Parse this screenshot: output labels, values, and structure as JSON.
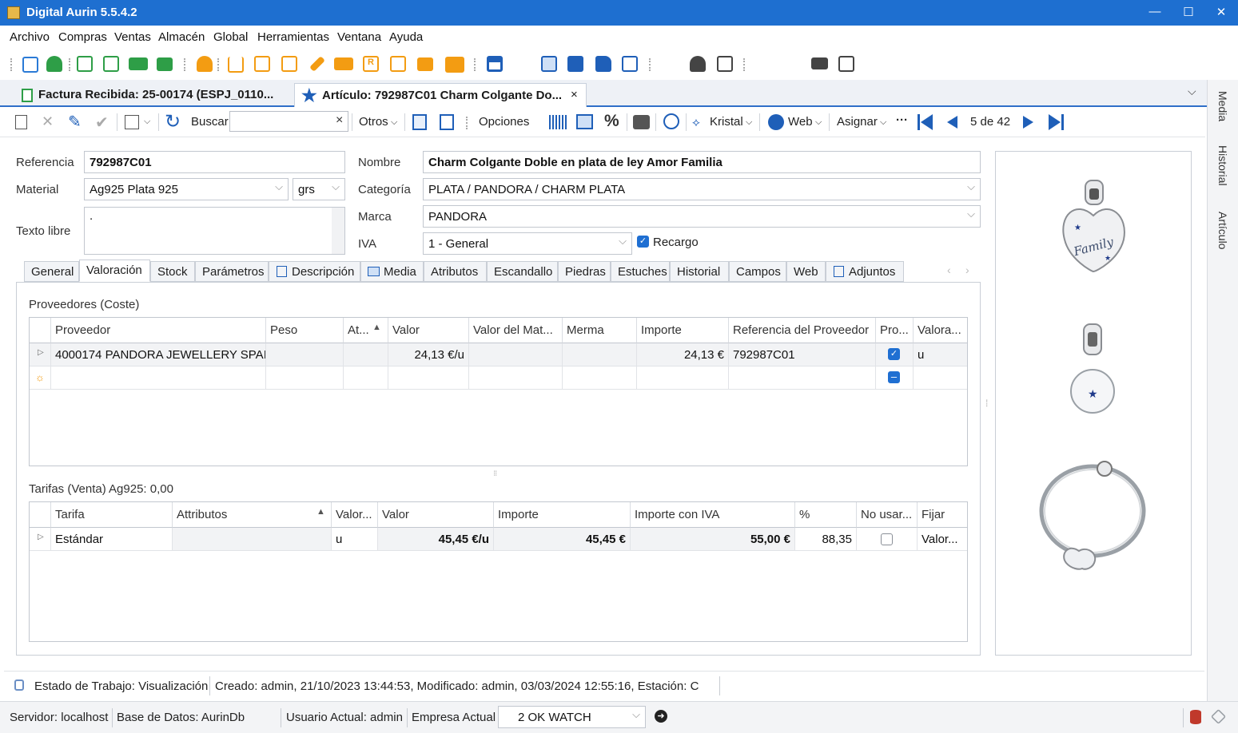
{
  "window": {
    "title": "Digital Aurin 5.5.4.2"
  },
  "menu": [
    "Archivo",
    "Compras",
    "Ventas",
    "Almacén",
    "Global",
    "Herramientas",
    "Ventana",
    "Ayuda"
  ],
  "doc_tabs": [
    {
      "label": "Factura Recibida: 25-00174 (ESPJ_0110..."
    },
    {
      "label": "Artículo: 792987C01 Charm Colgante Do...",
      "close": "×"
    }
  ],
  "side_tabs": [
    "Media",
    "Historial",
    "Artículo"
  ],
  "toolbar": {
    "buscar": "Buscar",
    "search_value": "",
    "search_clear": "×",
    "otros": "Otros",
    "opciones": "Opciones",
    "kristal": "Kristal",
    "web": "Web",
    "asignar": "Asignar",
    "more": "···",
    "page": "5 de 42"
  },
  "form": {
    "referencia_label": "Referencia",
    "referencia": "792987C01",
    "material_label": "Material",
    "material": "Ag925 Plata 925",
    "unit": "grs",
    "texto_libre_label": "Texto libre",
    "texto_libre": ".",
    "nombre_label": "Nombre",
    "nombre": "Charm Colgante Doble en plata de ley Amor Familia",
    "categoria_label": "Categoría",
    "categoria": "PLATA / PANDORA / CHARM PLATA",
    "marca_label": "Marca",
    "marca": "PANDORA",
    "iva_label": "IVA",
    "iva": "1 - General",
    "recargo": "Recargo"
  },
  "panel_tabs": [
    "General",
    "Valoración",
    "Stock",
    "Parámetros",
    "Descripción",
    "Media",
    "Atributos",
    "Escandallo",
    "Piedras",
    "Estuches",
    "Historial",
    "Campos",
    "Web",
    "Adjuntos"
  ],
  "proveedores": {
    "title": "Proveedores (Coste)",
    "columns": [
      "Proveedor",
      "Peso",
      "At...",
      "Valor",
      "Valor del Mat...",
      "Merma",
      "Importe",
      "Referencia del Proveedor",
      "Pro...",
      "Valora..."
    ],
    "rows": [
      {
        "proveedor": "4000174  PANDORA JEWELLERY SPAI...",
        "peso": "",
        "at": "",
        "valor": "24,13 €/u",
        "valor_mat": "",
        "merma": "",
        "importe": "24,13 €",
        "ref": "792987C01",
        "pro": true,
        "valora": "u"
      }
    ]
  },
  "tarifas": {
    "title": "Tarifas (Venta) Ag925: 0,00",
    "columns": [
      "Tarifa",
      "Attributos",
      "Valor...",
      "Valor",
      "Importe",
      "Importe con IVA",
      "%",
      "No usar...",
      "Fijar"
    ],
    "rows": [
      {
        "tarifa": "Estándar",
        "attr": "",
        "valor_u": "u",
        "valor": "45,45 €/u",
        "importe": "45,45 €",
        "importe_iva": "55,00 €",
        "pct": "88,35",
        "no_usar": false,
        "fijar": "Valor..."
      }
    ]
  },
  "status": {
    "estado": "Estado de Trabajo: Visualización",
    "creado": "Creado: admin, 21/10/2023 13:44:53, Modificado: admin, 03/03/2024 12:55:16, Estación: C",
    "servidor": "Servidor: localhost",
    "base": "Base de Datos: AurinDb",
    "usuario": "Usuario Actual: admin",
    "empresa_label": "Empresa Actual",
    "empresa": "2  OK WATCH"
  },
  "images": {
    "charm1_text": "Family",
    "colors": {
      "accent": "#1f6fd2",
      "titlebar": "#1e6fd0",
      "orange": "#f39c12",
      "green": "#2e9e47"
    }
  }
}
